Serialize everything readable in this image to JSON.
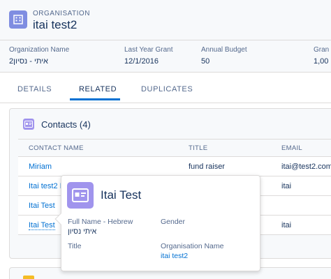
{
  "header": {
    "object_type": "ORGANISATION",
    "title": "itai test2"
  },
  "highlights": [
    {
      "label": "Organization Name",
      "value": "איתי - נסיון2"
    },
    {
      "label": "Last Year Grant",
      "value": "12/1/2016"
    },
    {
      "label": "Annual Budget",
      "value": "50"
    },
    {
      "label": "Gran",
      "value": "1,00"
    }
  ],
  "tabs": [
    {
      "label": "DETAILS",
      "active": false
    },
    {
      "label": "RELATED",
      "active": true
    },
    {
      "label": "DUPLICATES",
      "active": false
    }
  ],
  "contacts": {
    "title": "Contacts (4)",
    "columns": [
      "CONTACT NAME",
      "TITLE",
      "EMAIL"
    ],
    "rows": [
      {
        "name": "Miriam",
        "title": "fund raiser",
        "email": "itai@test2.com"
      },
      {
        "name": "Itai test2 I",
        "title": "",
        "email": "itai"
      },
      {
        "name": "Itai Test",
        "title": "",
        "email": ""
      },
      {
        "name": "Itai Test",
        "title": "",
        "email": "itai"
      }
    ]
  },
  "popover": {
    "title": "Itai Test",
    "fields": {
      "full_name_label": "Full Name - Hebrew",
      "full_name_value": "איתי נסיון",
      "gender_label": "Gender",
      "gender_value": "",
      "title_label": "Title",
      "title_value": "",
      "org_label": "Organisation Name",
      "org_value": "itai test2"
    }
  },
  "colors": {
    "accent": "#0070d2",
    "org_icon": "#7f8de1",
    "contact_icon": "#a094ed",
    "text_dark": "#16325c",
    "text_muted": "#54698d"
  },
  "icons": {
    "org": "building-icon",
    "contact": "contact-card-icon"
  }
}
